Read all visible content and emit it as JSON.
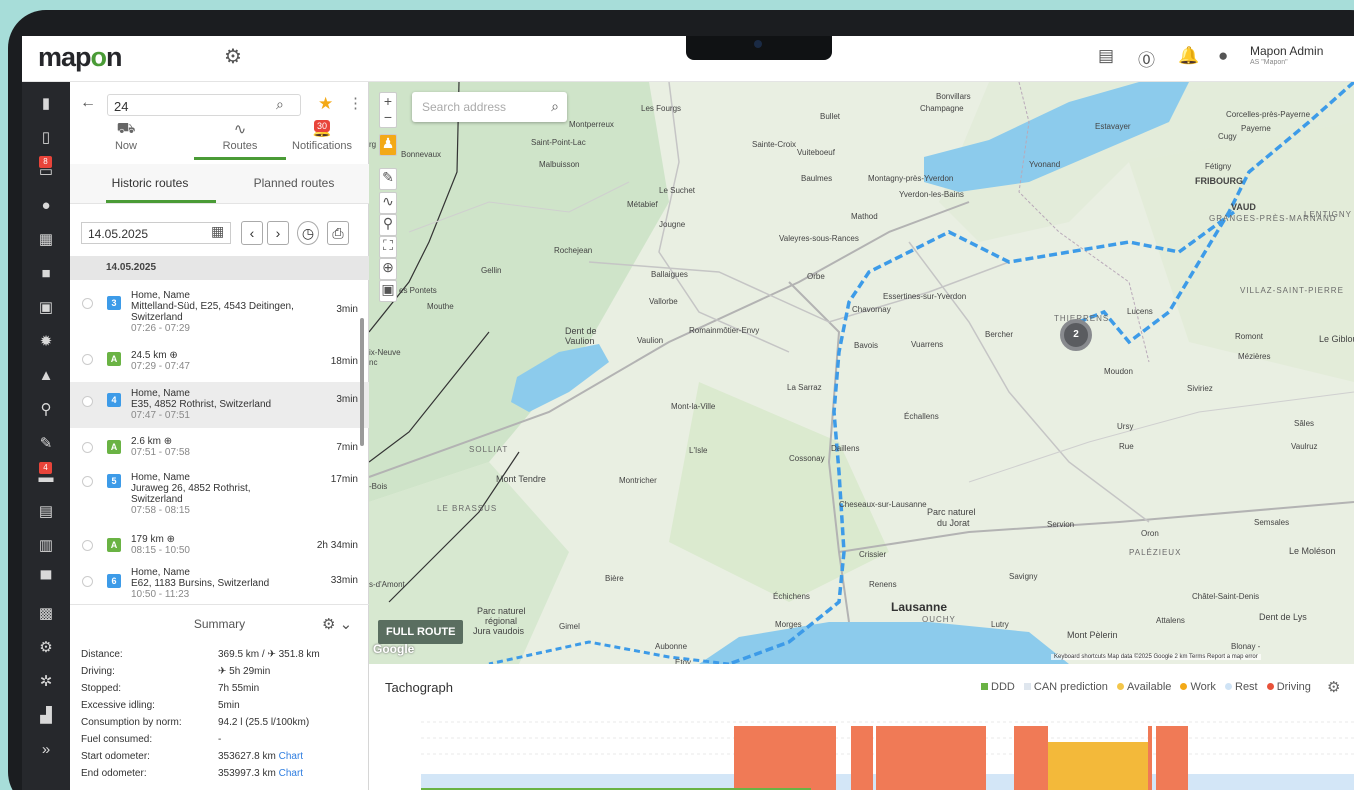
{
  "app": {
    "logo_prefix": "map",
    "logo_o": "o",
    "logo_suffix": "n",
    "admin_name": "Mapon Admin",
    "admin_company": "AS \"Mapon\""
  },
  "search": {
    "value": "24"
  },
  "tabs": [
    {
      "label": "Now",
      "icon": "car-icon"
    },
    {
      "label": "Routes",
      "icon": "route-icon"
    },
    {
      "label": "Notifications",
      "icon": "bell-icon"
    }
  ],
  "notifications_badge": "30",
  "subtabs": {
    "historic": "Historic routes",
    "planned": "Planned routes"
  },
  "date": "14.05.2025",
  "day_header": "14.05.2025",
  "sidebar_badges": [
    "8",
    "4"
  ],
  "routes": [
    {
      "badge": "3",
      "type": "stop",
      "title": "Home, Name",
      "address": "Mittelland-Süd, E25, 4543 Deitingen,",
      "address2": "Switzerland",
      "time": "07:26 - 07:29",
      "duration": "3min"
    },
    {
      "badge": "A",
      "type": "drive",
      "title": "24.5 km ⊕",
      "address": "",
      "address2": "",
      "time": "07:29 - 07:47",
      "duration": "18min"
    },
    {
      "badge": "4",
      "type": "stop",
      "title": "Home, Name",
      "address": "E35, 4852 Rothrist, Switzerland",
      "address2": "",
      "time": "07:47 - 07:51",
      "duration": "3min"
    },
    {
      "badge": "A",
      "type": "drive",
      "title": "2.6 km ⊕",
      "address": "",
      "address2": "",
      "time": "07:51 - 07:58",
      "duration": "7min"
    },
    {
      "badge": "5",
      "type": "stop",
      "title": "Home, Name",
      "address": "Juraweg 26, 4852 Rothrist,",
      "address2": "Switzerland",
      "time": "07:58 - 08:15",
      "duration": "17min"
    },
    {
      "badge": "A",
      "type": "drive",
      "title": "179 km ⊕",
      "address": "",
      "address2": "",
      "time": "08:15 - 10:50",
      "duration": "2h 34min"
    },
    {
      "badge": "6",
      "type": "stop",
      "title": "Home, Name",
      "address": "E62, 1183 Bursins, Switzerland",
      "address2": "",
      "time": "10:50 - 11:23",
      "duration": "33min"
    }
  ],
  "summary": {
    "title": "Summary",
    "rows": [
      {
        "label": "Distance:",
        "value": "369.5 km / ✈ 351.8 km"
      },
      {
        "label": "Driving:",
        "value": "✈ 5h 29min"
      },
      {
        "label": "Stopped:",
        "value": "7h 55min"
      },
      {
        "label": "Excessive idling:",
        "value": "5min"
      },
      {
        "label": "Consumption by norm:",
        "value": "94.2 l (25.5 l/100km)"
      },
      {
        "label": "Fuel consumed:",
        "value": "-"
      },
      {
        "label": "Start odometer:",
        "value": "353627.8 km",
        "link": "Chart"
      },
      {
        "label": "End odometer:",
        "value": "353997.3 km",
        "link": "Chart"
      }
    ]
  },
  "map": {
    "search_placeholder": "Search address",
    "full_route": "FULL ROUTE",
    "cluster_count": "2",
    "footer": "Keyboard shortcuts   Map data ©2025 Google   2 km   Terms   Report a map error",
    "google": "Google"
  },
  "tacho": {
    "title": "Tachograph",
    "legend": [
      {
        "label": "DDD",
        "color": "#6ab344",
        "shape": "square"
      },
      {
        "label": "CAN prediction",
        "color": "#dfe6ee",
        "shape": "square"
      },
      {
        "label": "Available",
        "color": "#f3c64a",
        "shape": "circle"
      },
      {
        "label": "Work",
        "color": "#f3a917",
        "shape": "circle"
      },
      {
        "label": "Rest",
        "color": "#cfe3f5",
        "shape": "circle"
      },
      {
        "label": "Driving",
        "color": "#e8523a",
        "shape": "circle"
      }
    ]
  },
  "colors": {
    "accent": "#4a9b36",
    "route": "#3d9be8",
    "driving": "#f07a56",
    "work": "#f3b93a",
    "rest": "#d3e6f7",
    "sidebar": "#26282c"
  }
}
